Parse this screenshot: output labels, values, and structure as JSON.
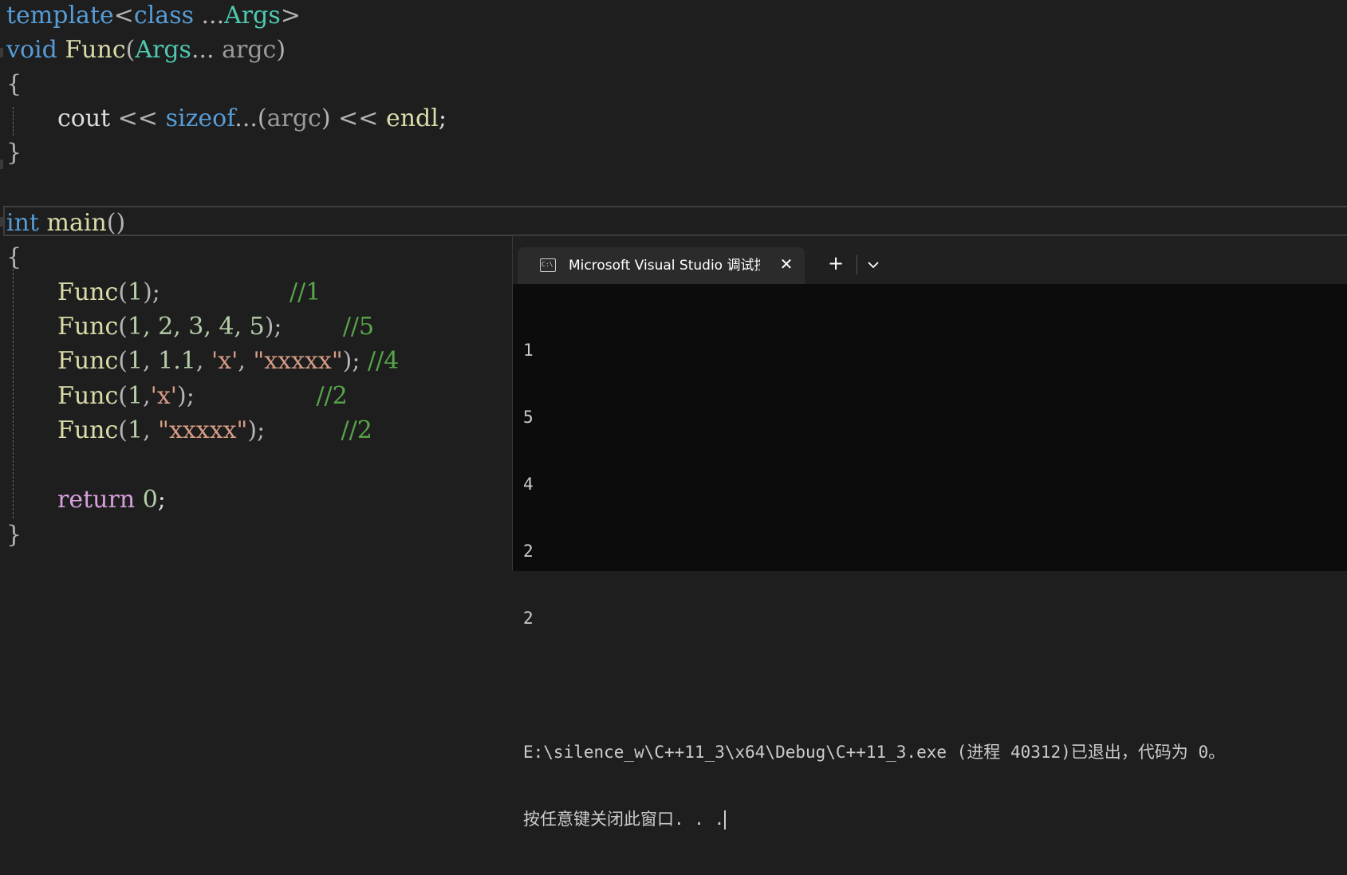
{
  "editor": {
    "line1": {
      "kw_template": "template",
      "lt": "<",
      "kw_class": "class",
      "ellipsis": " ...",
      "type_args": "Args",
      "gt": ">"
    },
    "line2": {
      "kw_void": "void",
      "fn_name": "Func",
      "open": "(",
      "type_args": "Args",
      "ellipsis": "...",
      "param": "argc",
      "close": ")"
    },
    "line3": {
      "brace": "{"
    },
    "line4": {
      "cout": "cout",
      "op1": "<<",
      "kw_sizeof": "sizeof",
      "ellipsis": "...",
      "paren_open": "(",
      "param": "argc",
      "paren_close": ")",
      "op2": "<<",
      "endl": "endl",
      "semi": ";"
    },
    "line5": {
      "brace": "}"
    },
    "line7": {
      "kw_int": "int",
      "fn_main": "main",
      "parens": "()"
    },
    "line8": {
      "brace": "{"
    },
    "calls": [
      {
        "fn": "Func",
        "args_pre": "(",
        "num1": "1",
        "args_post": ");",
        "pad": "                 ",
        "comment": "//1"
      },
      {
        "fn": "Func",
        "args_pre": "(",
        "nums": "1, 2, 3, 4, 5",
        "args_post": ");",
        "pad": "        ",
        "comment": "//5"
      },
      {
        "fn": "Func",
        "args_pre": "(",
        "num1": "1",
        "sep1": ", ",
        "num2": "1.1",
        "sep2": ", ",
        "char": "'x'",
        "sep3": ", ",
        "str": "\"xxxxx\"",
        "args_post": ");",
        "pad": " ",
        "comment": "//4"
      },
      {
        "fn": "Func",
        "args_pre": "(",
        "num1": "1",
        "sep1": ",",
        "char": "'x'",
        "args_post": ");",
        "pad": "                ",
        "comment": "//2"
      },
      {
        "fn": "Func",
        "args_pre": "(",
        "num1": "1",
        "sep1": ", ",
        "str": "\"xxxxx\"",
        "args_post": ");",
        "pad": "          ",
        "comment": "//2"
      }
    ],
    "line15": {
      "kw_return": "return",
      "num": "0",
      "semi": ";"
    },
    "line16": {
      "brace": "}"
    }
  },
  "terminal": {
    "tab_icon_text": "C:\\",
    "tab_title": "Microsoft Visual Studio 调试控",
    "tab_close": "✕",
    "new_tab": "+",
    "output_lines": [
      "1",
      "5",
      "4",
      "2",
      "2"
    ],
    "exit_message": "E:\\silence_w\\C++11_3\\x64\\Debug\\C++11_3.exe (进程 40312)已退出，代码为 0。",
    "prompt_message": "按任意键关闭此窗口. . ."
  },
  "colors": {
    "editor_bg": "#1e1e1e",
    "keyword": "#569cd6",
    "type": "#4ec9b0",
    "function": "#dcdcaa",
    "number": "#b5cea8",
    "string": "#d69d85",
    "comment": "#57a64a",
    "control": "#d8a0df",
    "terminal_bg": "#0c0c0c"
  }
}
